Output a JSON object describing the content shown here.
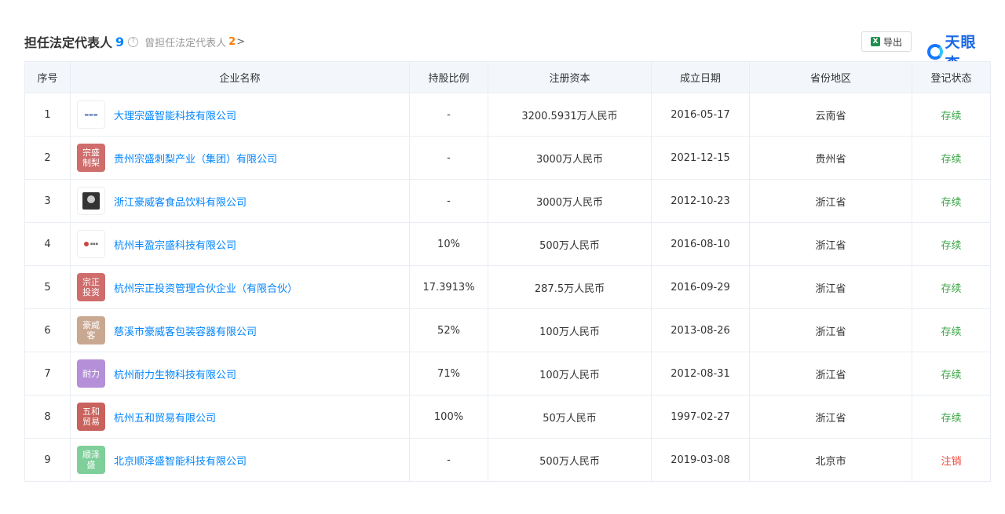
{
  "header": {
    "title": "担任法定代表人",
    "count": "9",
    "help_icon": "?",
    "former_label": "曾担任法定代表人",
    "former_count": "2",
    "former_arrow": ">",
    "export_icon": "X",
    "export_label": "导出",
    "brand": "天眼查"
  },
  "columns": [
    "序号",
    "企业名称",
    "持股比例",
    "注册资本",
    "成立日期",
    "省份地区",
    "登记状态"
  ],
  "rows": [
    {
      "no": "1",
      "logo_type": "img",
      "logo_text": "",
      "logo_color": "#ffffff",
      "name": "大理宗盛智能科技有限公司",
      "share": "-",
      "capital": "3200.5931万人民币",
      "date": "2016-05-17",
      "province": "云南省",
      "status": "存续",
      "status_kind": "active"
    },
    {
      "no": "2",
      "logo_type": "text",
      "logo_text": "宗盛\n制梨",
      "logo_color": "#cf6c6c",
      "name": "贵州宗盛刺梨产业（集团）有限公司",
      "share": "-",
      "capital": "3000万人民币",
      "date": "2021-12-15",
      "province": "贵州省",
      "status": "存续",
      "status_kind": "active"
    },
    {
      "no": "3",
      "logo_type": "portrait",
      "logo_text": "",
      "logo_color": "#ffffff",
      "name": "浙江豪威客食品饮料有限公司",
      "share": "-",
      "capital": "3000万人民币",
      "date": "2012-10-23",
      "province": "浙江省",
      "status": "存续",
      "status_kind": "active"
    },
    {
      "no": "4",
      "logo_type": "dot",
      "logo_text": "",
      "logo_color": "#ffffff",
      "name": "杭州丰盈宗盛科技有限公司",
      "share": "10%",
      "capital": "500万人民币",
      "date": "2016-08-10",
      "province": "浙江省",
      "status": "存续",
      "status_kind": "active"
    },
    {
      "no": "5",
      "logo_type": "text",
      "logo_text": "宗正\n投资",
      "logo_color": "#cf6c6c",
      "name": "杭州宗正投资管理合伙企业（有限合伙）",
      "share": "17.3913%",
      "capital": "287.5万人民币",
      "date": "2016-09-29",
      "province": "浙江省",
      "status": "存续",
      "status_kind": "active"
    },
    {
      "no": "6",
      "logo_type": "text",
      "logo_text": "豪威\n客",
      "logo_color": "#c9a892",
      "name": "慈溪市豪威客包装容器有限公司",
      "share": "52%",
      "capital": "100万人民币",
      "date": "2013-08-26",
      "province": "浙江省",
      "status": "存续",
      "status_kind": "active"
    },
    {
      "no": "7",
      "logo_type": "text",
      "logo_text": "耐力",
      "logo_color": "#b58fd8",
      "name": "杭州耐力生物科技有限公司",
      "share": "71%",
      "capital": "100万人民币",
      "date": "2012-08-31",
      "province": "浙江省",
      "status": "存续",
      "status_kind": "active"
    },
    {
      "no": "8",
      "logo_type": "text",
      "logo_text": "五和\n贸易",
      "logo_color": "#c9625c",
      "name": "杭州五和贸易有限公司",
      "share": "100%",
      "capital": "50万人民币",
      "date": "1997-02-27",
      "province": "浙江省",
      "status": "存续",
      "status_kind": "active"
    },
    {
      "no": "9",
      "logo_type": "text",
      "logo_text": "顺泽\n盛",
      "logo_color": "#7fcf9a",
      "name": "北京顺泽盛智能科技有限公司",
      "share": "-",
      "capital": "500万人民币",
      "date": "2019-03-08",
      "province": "北京市",
      "status": "注销",
      "status_kind": "cancel"
    }
  ]
}
